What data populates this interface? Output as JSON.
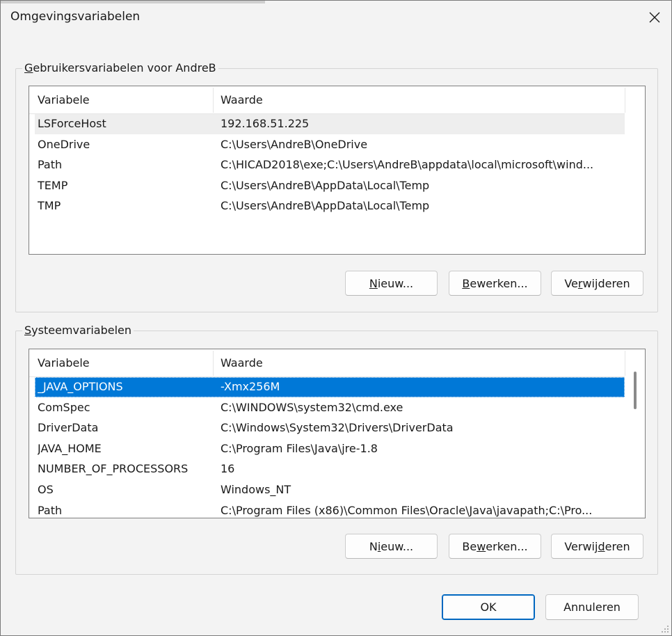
{
  "window": {
    "title": "Omgevingsvariabelen",
    "close_icon": "close-icon"
  },
  "user_group": {
    "label_prefix": "",
    "label_accel": "G",
    "label_rest": "ebruikersvariabelen voor AndreB",
    "columns": [
      "Variabele",
      "Waarde"
    ],
    "rows": [
      {
        "name": "LSForceHost",
        "value": "192.168.51.225"
      },
      {
        "name": "OneDrive",
        "value": "C:\\Users\\AndreB\\OneDrive"
      },
      {
        "name": "Path",
        "value": "C:\\HICAD2018\\exe;C:\\Users\\AndreB\\appdata\\local\\microsoft\\wind..."
      },
      {
        "name": "TEMP",
        "value": "C:\\Users\\AndreB\\AppData\\Local\\Temp"
      },
      {
        "name": "TMP",
        "value": "C:\\Users\\AndreB\\AppData\\Local\\Temp"
      }
    ],
    "buttons": {
      "new": {
        "pre": "",
        "accel": "N",
        "post": "ieuw..."
      },
      "edit": {
        "pre": "",
        "accel": "B",
        "post": "ewerken..."
      },
      "delete": {
        "pre": "Ve",
        "accel": "r",
        "post": "wijderen"
      }
    }
  },
  "system_group": {
    "label_prefix": "",
    "label_accel": "S",
    "label_rest": "ysteemvariabelen",
    "columns": [
      "Variabele",
      "Waarde"
    ],
    "rows": [
      {
        "name": "_JAVA_OPTIONS",
        "value": "-Xmx256M"
      },
      {
        "name": "ComSpec",
        "value": "C:\\WINDOWS\\system32\\cmd.exe"
      },
      {
        "name": "DriverData",
        "value": "C:\\Windows\\System32\\Drivers\\DriverData"
      },
      {
        "name": "JAVA_HOME",
        "value": "C:\\Program Files\\Java\\jre-1.8"
      },
      {
        "name": "NUMBER_OF_PROCESSORS",
        "value": "16"
      },
      {
        "name": "OS",
        "value": "Windows_NT"
      },
      {
        "name": "Path",
        "value": "C:\\Program Files (x86)\\Common Files\\Oracle\\Java\\javapath;C:\\Pro..."
      }
    ],
    "selected_row": "_JAVA_OPTIONS",
    "buttons": {
      "new": {
        "pre": "N",
        "accel": "i",
        "post": "euw..."
      },
      "edit": {
        "pre": "Be",
        "accel": "w",
        "post": "erken..."
      },
      "delete": {
        "pre": "Verwij",
        "accel": "d",
        "post": "eren"
      }
    }
  },
  "footer": {
    "ok": "OK",
    "cancel": "Annuleren"
  },
  "colors": {
    "selection": "#0078d7",
    "default_button_border": "#0067c0",
    "dialog_background": "#f3f3f3"
  }
}
